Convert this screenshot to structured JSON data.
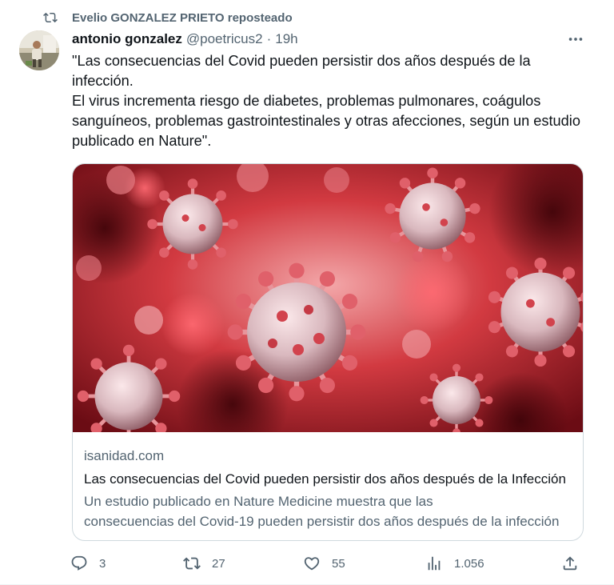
{
  "repost": {
    "text": "Evelio GONZALEZ PRIETO reposteado"
  },
  "author": {
    "name": "antonio gonzalez",
    "handle": "@poetricus2",
    "separator": "·",
    "time": "19h"
  },
  "tweet_lines": [
    "\"Las consecuencias del Covid pueden persistir dos años después de la infección.",
    "El virus incrementa riesgo de diabetes, problemas pulmonares, coágulos sanguíneos, problemas gastrointestinales y otras afecciones, según un estudio publicado en Nature\"."
  ],
  "card": {
    "domain": "isanidad.com",
    "title": "Las consecuencias del Covid pueden persistir dos años después de la Infección",
    "desc_line1": "Un estudio publicado en Nature Medicine muestra que las",
    "desc_line2": "consecuencias del Covid-19 pueden persistir dos años después de la infección"
  },
  "actions": {
    "replies": "3",
    "reposts": "27",
    "likes": "55",
    "views": "1.056"
  },
  "colors": {
    "text": "#0f1419",
    "secondary": "#536471",
    "border": "#cfd9de",
    "virus_bg": "#c4202a"
  },
  "icons": [
    "repost-icon",
    "more-icon",
    "reply-icon",
    "like-icon",
    "views-icon",
    "share-icon"
  ]
}
